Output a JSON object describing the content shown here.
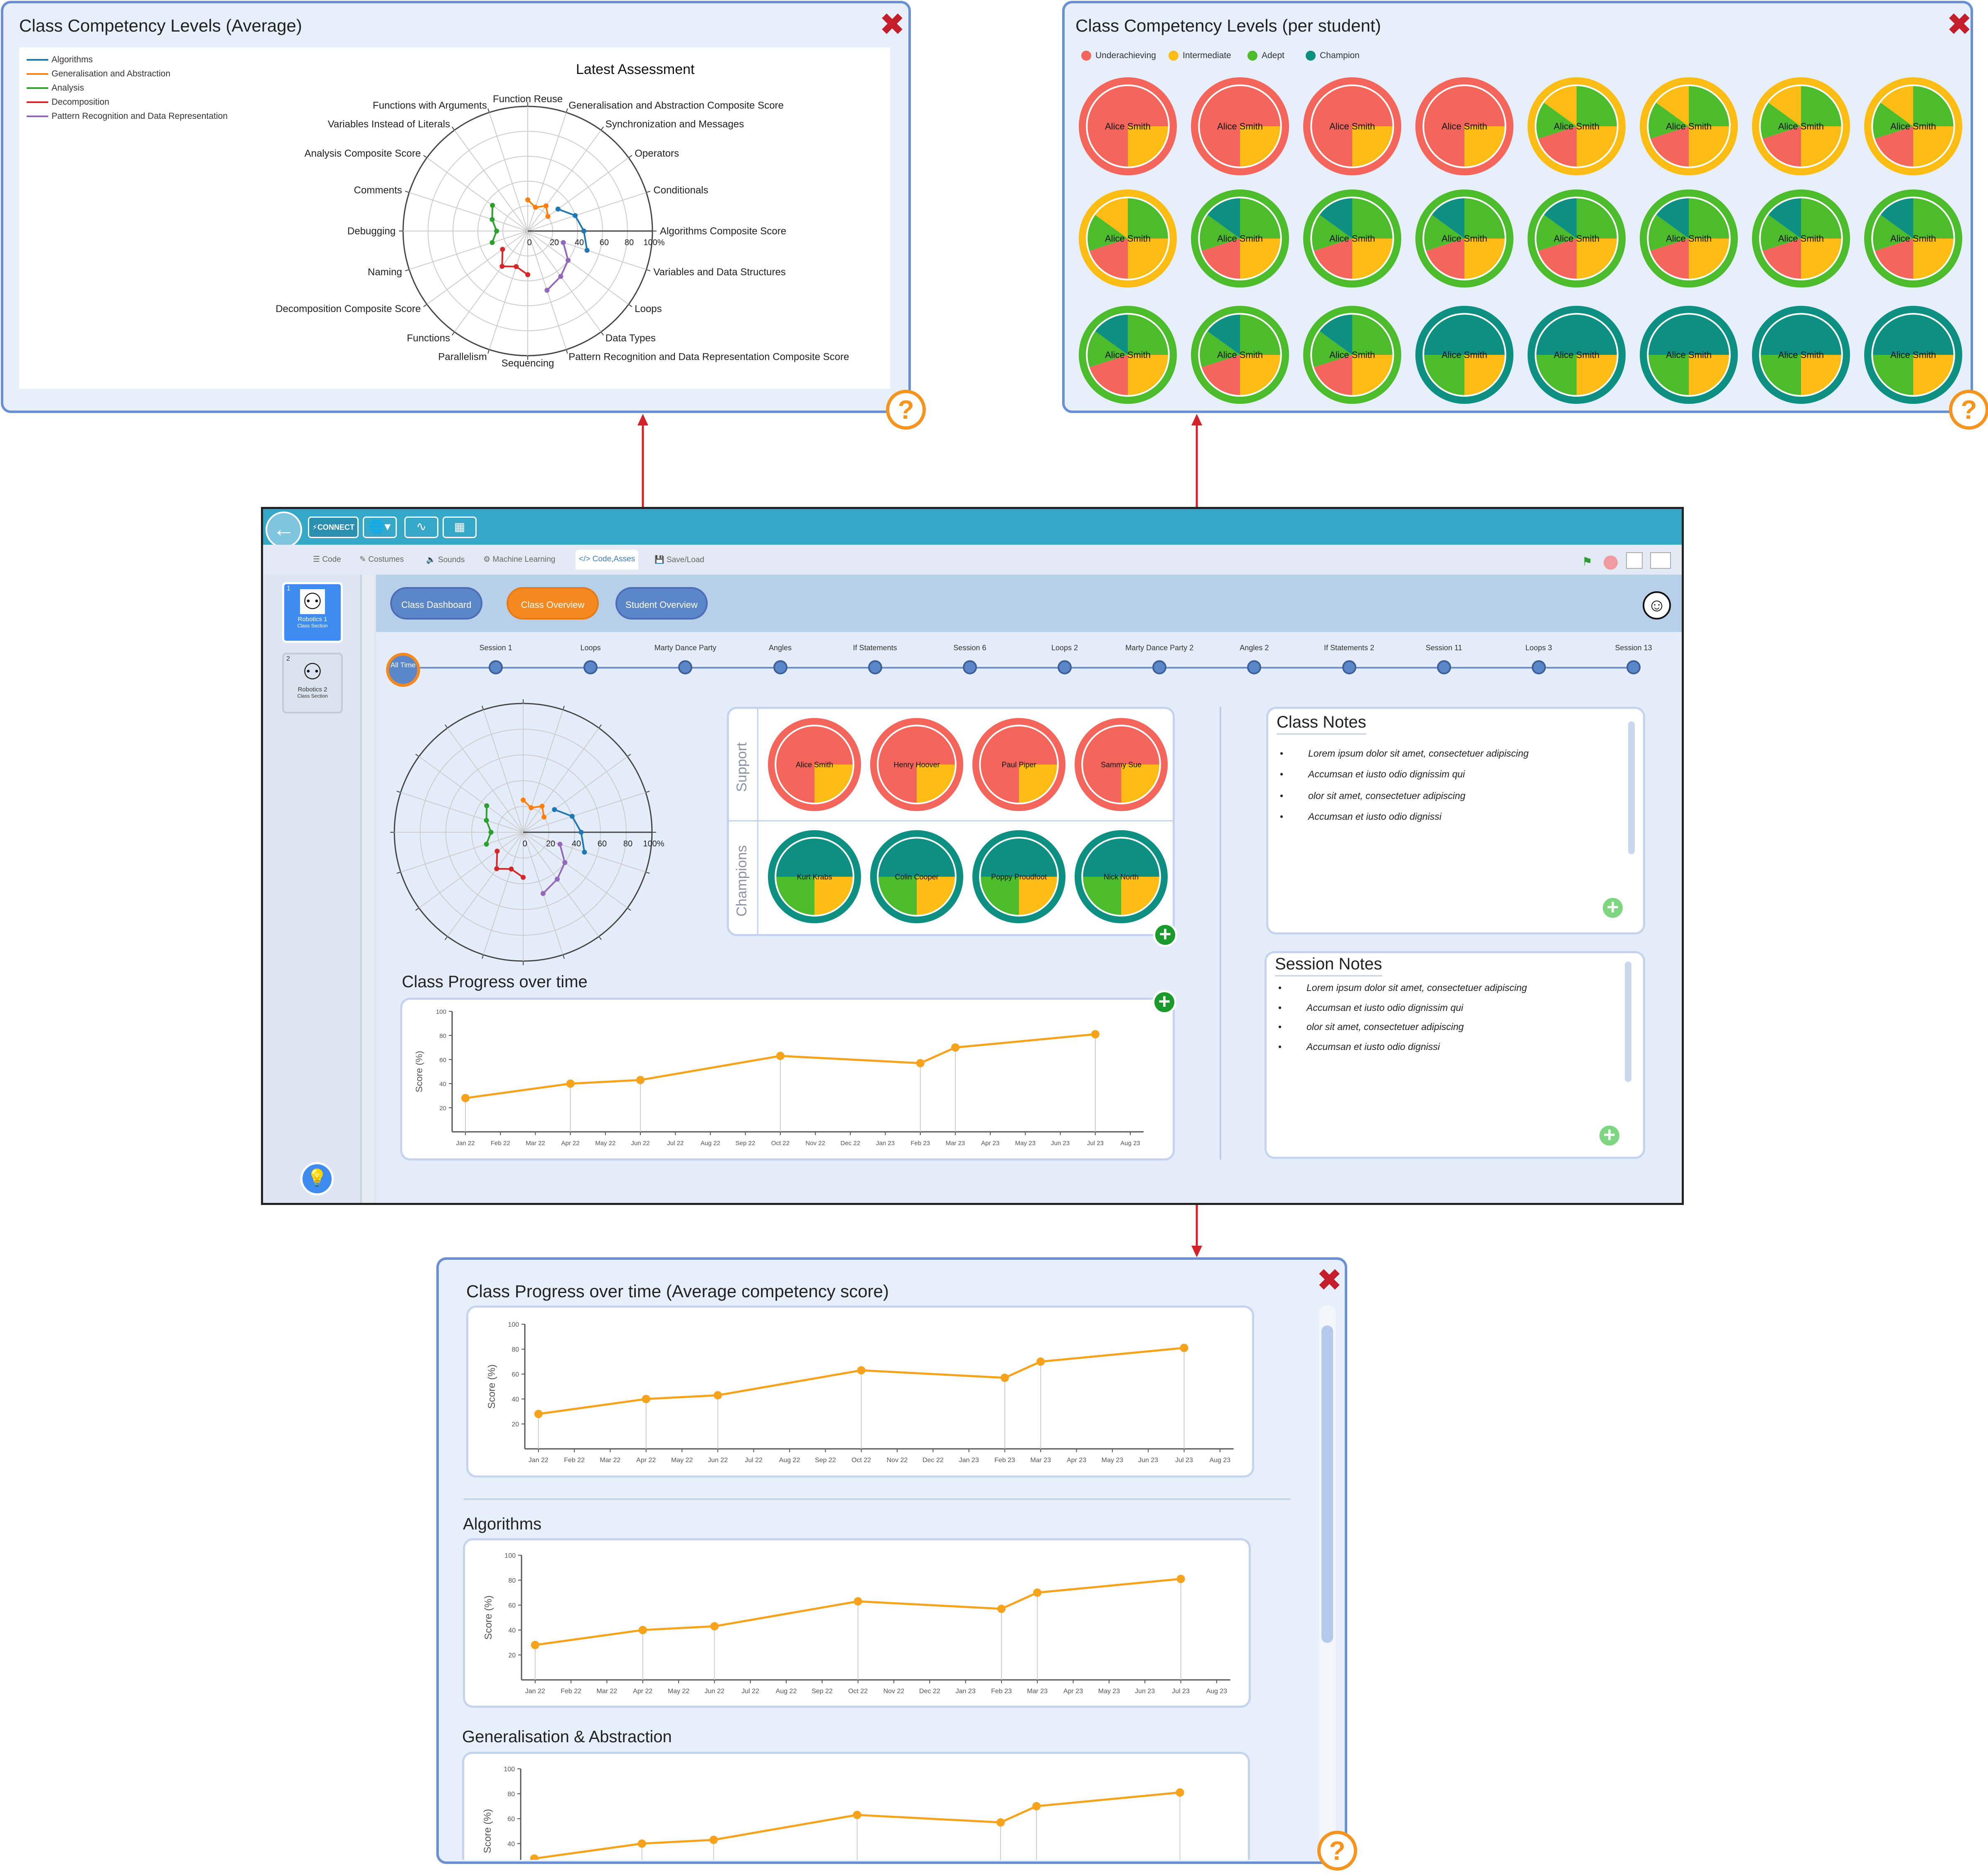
{
  "popup_average": {
    "title": "Class Competency Levels (Average)",
    "chart_title": "Latest Assessment",
    "legend": [
      {
        "name": "Algorithms",
        "color": "#1f77b4"
      },
      {
        "name": "Generalisation and Abstraction",
        "color": "#ff7f0e"
      },
      {
        "name": "Analysis",
        "color": "#2ca02c"
      },
      {
        "name": "Decomposition",
        "color": "#d62728"
      },
      {
        "name": "Pattern Recognition and Data Representation",
        "color": "#9467bd"
      }
    ],
    "axis_labels": [
      "Function Reuse",
      "Generalisation and Abstraction Composite Score",
      "Synchronization and Messages",
      "Operators",
      "Conditionals",
      "Algorithms Composite Score",
      "Variables and Data Structures",
      "Loops",
      "Data Types",
      "Pattern Recognition and Data Representation Composite Score",
      "Sequencing",
      "Parallelism",
      "Functions",
      "Decomposition Composite Score",
      "Naming",
      "Debugging",
      "Comments",
      "Analysis Composite Score",
      "Variables Instead of Literals",
      "Functions with Arguments"
    ],
    "radial_ticks": [
      "0",
      "20",
      "40",
      "60",
      "80",
      "100%"
    ]
  },
  "popup_per_student": {
    "title": "Class Competency Levels (per student)",
    "legend": [
      {
        "name": "Underachieving",
        "color": "#f4665c"
      },
      {
        "name": "Intermediate",
        "color": "#fbbd13"
      },
      {
        "name": "Adept",
        "color": "#4dbc2c"
      },
      {
        "name": "Champion",
        "color": "#0d9082"
      }
    ],
    "student_name": "Alice Smith",
    "rows": [
      [
        "U",
        "U",
        "U",
        "U",
        "I",
        "I",
        "I",
        "I"
      ],
      [
        "I",
        "A",
        "A",
        "A",
        "A",
        "A",
        "A",
        "A"
      ],
      [
        "A",
        "A",
        "A",
        "C",
        "C",
        "C",
        "C",
        "C"
      ]
    ]
  },
  "toolbar": {
    "connect": "CONNECT"
  },
  "tabs": [
    "Code",
    "Costumes",
    "Sounds",
    "Machine Learning",
    "Code,Asses",
    "Save/Load"
  ],
  "sidebar": {
    "items": [
      {
        "num": "1",
        "title": "Robotics 1",
        "sub": "Class Section"
      },
      {
        "num": "2",
        "title": "Robotics 2",
        "sub": "Class Section"
      }
    ]
  },
  "views": {
    "dashboard": "Class Dashboard",
    "overview": "Class Overview",
    "student": "Student Overview"
  },
  "timeline": {
    "first": "All Time",
    "sessions": [
      "Session 1",
      "Loops",
      "Marty Dance Party",
      "Angles",
      "If Statements",
      "Session 6",
      "Loops 2",
      "Marty Dance Party 2",
      "Angles 2",
      "If Statements 2",
      "Session 11",
      "Loops 3",
      "Session 13"
    ]
  },
  "groups": {
    "support_label": "Support",
    "champions_label": "Champions",
    "support": [
      "Alice Smith",
      "Henry Hoover",
      "Paul Piper",
      "Sammy Sue"
    ],
    "champions": [
      "Kurt Krabs",
      "Colin Cooper",
      "Poppy Proudfoot",
      "Nick North"
    ]
  },
  "class_progress": {
    "title": "Class Progress over time"
  },
  "class_notes": {
    "title": "Class Notes",
    "items": [
      "Lorem ipsum dolor sit amet, consectetuer adipiscing",
      "Accumsan et iusto odio dignissim qui",
      "olor sit amet, consectetuer adipiscing",
      "Accumsan et iusto odio dignissi"
    ]
  },
  "session_notes": {
    "title": "Session Notes",
    "items": [
      "Lorem ipsum dolor sit amet, consectetuer adipiscing",
      "Accumsan et iusto odio dignissim qui",
      "olor sit amet, consectetuer adipiscing",
      "Accumsan et iusto odio dignissi"
    ]
  },
  "popup_progress": {
    "title": "Class Progress over time (Average competency score)",
    "sections": [
      "Algorithms",
      "Generalisation & Abstraction"
    ]
  },
  "chart_data": {
    "type": "line",
    "ylabel": "Score (%)",
    "y_ticks": [
      20,
      40,
      60,
      80,
      100
    ],
    "x_ticks": [
      "Jan 22",
      "Feb 22",
      "Mar 22",
      "Apr 22",
      "May 22",
      "Jun 22",
      "Jul 22",
      "Aug 22",
      "Sep 22",
      "Oct 22",
      "Nov 22",
      "Dec 22",
      "Jan 23",
      "Feb 23",
      "Mar 23",
      "Apr 23",
      "May 23",
      "Jun 23",
      "Jul 23",
      "Aug 23"
    ],
    "points": [
      {
        "x": "Jan 22",
        "y": 28
      },
      {
        "x": "Apr 22",
        "y": 40
      },
      {
        "x": "Jun 22",
        "y": 43
      },
      {
        "x": "Oct 22",
        "y": 63
      },
      {
        "x": "Feb 23",
        "y": 57
      },
      {
        "x": "Mar 23",
        "y": 70
      },
      {
        "x": "Jul 23",
        "y": 81
      }
    ],
    "radar": [
      {
        "series": "Algorithms",
        "values": [
          30,
          40,
          45,
          50
        ]
      },
      {
        "series": "Generalisation and Abstraction",
        "values": [
          25,
          20,
          25,
          20
        ]
      },
      {
        "series": "Analysis",
        "values": [
          30,
          25,
          30,
          35
        ]
      },
      {
        "series": "Decomposition",
        "values": [
          35,
          30,
          35,
          25
        ]
      },
      {
        "series": "Pattern Recognition and Data Representation",
        "values": [
          30,
          40,
          45,
          50
        ]
      }
    ]
  }
}
